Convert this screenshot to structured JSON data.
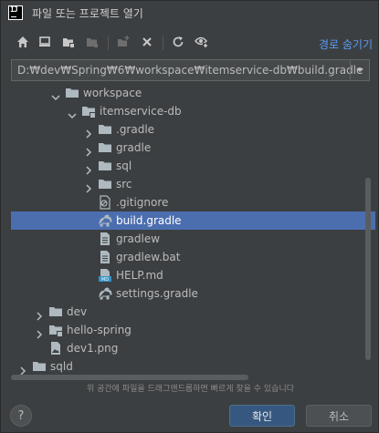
{
  "window": {
    "title": "파일 또는 프로젝트 열기",
    "app_logo_text": "IJ"
  },
  "toolbar": {
    "hide_path_label": "경로 숨기기",
    "buttons": [
      "home-icon",
      "desktop-icon",
      "project-folder-icon",
      "module-folder-icon",
      "new-folder-icon",
      "delete-icon",
      "refresh-icon",
      "show-hidden-icon"
    ]
  },
  "path": {
    "value": "D:₩dev₩Spring₩6₩workspace₩itemservice-db₩build.gradle"
  },
  "tree": {
    "items": [
      {
        "label": "workspace",
        "icon": "folder-icon",
        "arrow": "expanded",
        "level": 3
      },
      {
        "label": "itemservice-db",
        "icon": "module-folder-icon",
        "arrow": "expanded",
        "level": 4
      },
      {
        "label": ".gradle",
        "icon": "folder-icon",
        "arrow": "collapsed",
        "level": 5
      },
      {
        "label": "gradle",
        "icon": "folder-icon",
        "arrow": "collapsed",
        "level": 5
      },
      {
        "label": "sql",
        "icon": "folder-icon",
        "arrow": "collapsed",
        "level": 5
      },
      {
        "label": "src",
        "icon": "folder-icon",
        "arrow": "collapsed",
        "level": 5
      },
      {
        "label": ".gitignore",
        "icon": "gitignore-icon",
        "arrow": "none",
        "level": 5
      },
      {
        "label": "build.gradle",
        "icon": "gradle-elephant-icon",
        "arrow": "none",
        "level": 5,
        "selected": true
      },
      {
        "label": "gradlew",
        "icon": "text-file-icon",
        "arrow": "none",
        "level": 5
      },
      {
        "label": "gradlew.bat",
        "icon": "text-file-icon",
        "arrow": "none",
        "level": 5
      },
      {
        "label": "HELP.md",
        "icon": "markdown-file-icon",
        "arrow": "none",
        "level": 5
      },
      {
        "label": "settings.gradle",
        "icon": "gradle-elephant-icon",
        "arrow": "none",
        "level": 5
      },
      {
        "label": "dev",
        "icon": "folder-icon",
        "arrow": "collapsed",
        "level": 2
      },
      {
        "label": "hello-spring",
        "icon": "module-folder-icon",
        "arrow": "collapsed",
        "level": 2
      },
      {
        "label": "dev1.png",
        "icon": "image-file-icon",
        "arrow": "none",
        "level": 2
      },
      {
        "label": "sqld",
        "icon": "folder-icon",
        "arrow": "collapsed",
        "level": 1
      },
      {
        "label": "",
        "icon": "folder-icon",
        "arrow": "collapsed",
        "level": 1
      }
    ]
  },
  "hint": "위 공간에 파일을 드래그앤드롭하면 빠르게 찾을 수 있습니다",
  "buttons": {
    "help": "?",
    "ok": "확인",
    "cancel": "취소"
  },
  "colors": {
    "background": "#3c3f41",
    "selection": "#4b6eaf",
    "link": "#589df6",
    "primary_button": "#365880"
  }
}
